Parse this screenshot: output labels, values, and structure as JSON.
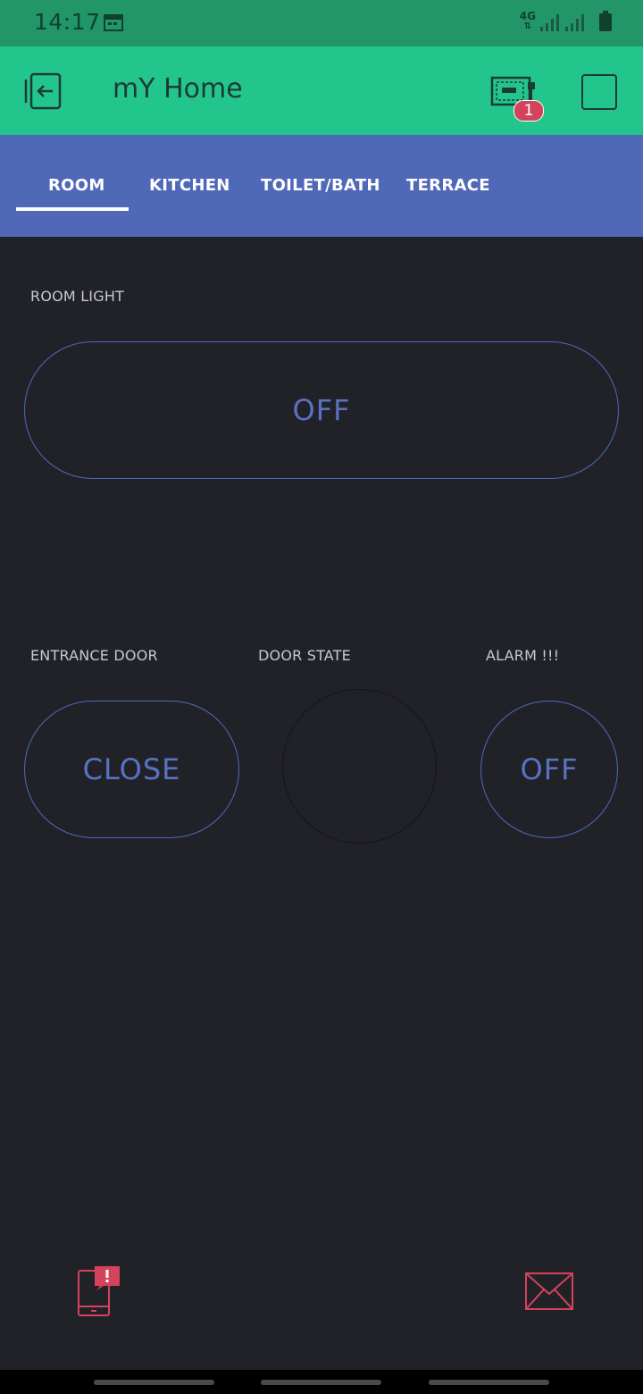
{
  "status_bar": {
    "time": "14:17",
    "network": "4G"
  },
  "app_bar": {
    "title": "mY Home",
    "device_badge_count": "1"
  },
  "tabs": [
    {
      "label": "ROOM",
      "active": true
    },
    {
      "label": "KITCHEN",
      "active": false
    },
    {
      "label": "TOILET/BATH",
      "active": false
    },
    {
      "label": "TERRACE",
      "active": false
    }
  ],
  "widgets": {
    "room_light": {
      "label": "ROOM LIGHT",
      "value": "OFF"
    },
    "entrance_door": {
      "label": "ENTRANCE DOOR",
      "value": "CLOSE"
    },
    "door_state": {
      "label": "DOOR STATE"
    },
    "alarm": {
      "label": "ALARM !!!",
      "value": "OFF"
    }
  },
  "bottom_icons": {
    "left": "phone-alert-icon",
    "right": "mail-icon"
  },
  "colors": {
    "status_bar": "#239669",
    "app_bar": "#22c68d",
    "tab_bar": "#5068b8",
    "background": "#212228",
    "accent_blue": "#5a72c4",
    "alert_red": "#d3435c"
  }
}
